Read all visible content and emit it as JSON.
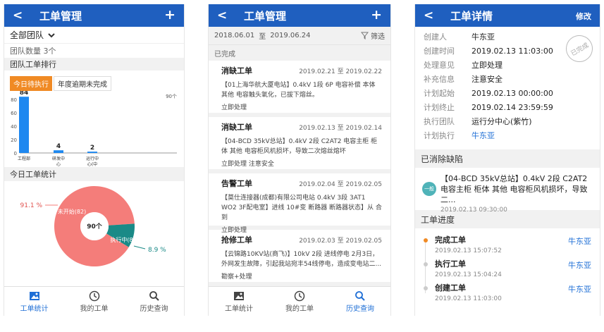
{
  "screen1": {
    "header": {
      "back": "<",
      "title": "工单管理",
      "add": "+"
    },
    "team_select": "全部团队",
    "team_count": "团队数量 3个",
    "ranking_title": "团队工单排行",
    "tabs": [
      "今日待执行",
      "年度逾期未完成"
    ],
    "count_label": "90个",
    "stats_title": "今日工单统计",
    "donut": {
      "center": "90个",
      "red_label": "未开始(82)",
      "teal_label": "执行中(8)",
      "red_pct": "91.1 %",
      "teal_pct": "8.9 %",
      "red_value": 82,
      "teal_value": 8,
      "red_color": "#f47d7a",
      "teal_color": "#1a8a87"
    },
    "tabbar": [
      {
        "label": "工单统计",
        "icon": "image-icon",
        "active": true
      },
      {
        "label": "我的工单",
        "icon": "clock-icon",
        "active": false
      },
      {
        "label": "历史查询",
        "icon": "search-icon",
        "active": false
      }
    ]
  },
  "chart_data": {
    "type": "bar",
    "categories": [
      "工程部",
      "研发中心",
      "运行中心"
    ],
    "values": [
      84,
      4,
      2
    ],
    "ylim": [
      0,
      80
    ],
    "yticks": [
      "0",
      "20",
      "40",
      "60",
      "80"
    ],
    "value_labels": [
      "84",
      "4",
      "2"
    ],
    "tick_labels": [
      [
        "工程部"
      ],
      [
        "研发中",
        "心"
      ],
      [
        "运行中",
        "心(中"
      ]
    ],
    "bar_color": "#1e88f0",
    "grid": false
  },
  "screen2": {
    "header": {
      "back": "<",
      "title": "工单管理",
      "add": "+"
    },
    "date_from": "2018.06.01",
    "date_sep": "至",
    "date_to": "2019.06.24",
    "filter": "筛选",
    "section": "已完成",
    "cards": [
      {
        "title": "消缺工单",
        "date": "2019.02.21 至 2019.02.22",
        "body": "【01上海华航大厦电站】0.4kV 1段 6P 电容补偿 本体 其他 电容触头氧化，已拔下熔丝。",
        "action": "立即处理"
      },
      {
        "title": "消缺工单",
        "date": "2019.02.13 至 2019.02.14",
        "body": "【04-BCD 35kV总站】0.4kV 2段 C2AT2 电容主柜 柜体 其他 电容柜风机损坏，导致二次熔丝熔坏",
        "action": "立即处理 注意安全"
      },
      {
        "title": "告警工单",
        "date": "2019.02.04 至 2019.02.05",
        "body": "【莫仕连接器(成都)有限公司电站 0.4kV 3段 3AT1 WO2 3F配电室】进线 10#变 断路器 断路器状态】从 合 到",
        "action": "立即处理"
      },
      {
        "title": "抢修工单",
        "date": "2019.02.03 至 2019.02.05",
        "body": "【云锦路10KV站(商飞)】10kV 2段 进线停电 2月3日，外网发生故障，引起我站宛丰54线停电，造成变电站二...",
        "action": "勘察+处理"
      }
    ],
    "tabbar": [
      {
        "label": "工单统计",
        "icon": "image-icon",
        "active": false
      },
      {
        "label": "我的工单",
        "icon": "clock-icon",
        "active": false
      },
      {
        "label": "历史查询",
        "icon": "search-icon",
        "active": true
      }
    ]
  },
  "screen3": {
    "header": {
      "back": "<",
      "title": "工单详情",
      "edit": "修改"
    },
    "stamp": "已完成",
    "fields": [
      {
        "k": "创建人",
        "v": "牛东亚"
      },
      {
        "k": "创建时间",
        "v": "2019.02.13 11:03:00"
      },
      {
        "k": "处理意见",
        "v": "立即处理"
      },
      {
        "k": "补充信息",
        "v": "注意安全"
      },
      {
        "k": "计划起始",
        "v": "2019.02.13 00:00:00"
      },
      {
        "k": "计划终止",
        "v": "2019.02.14 23:59:59"
      },
      {
        "k": "执行团队",
        "v": "运行分中心(紫竹)"
      },
      {
        "k": "计划执行",
        "v": "牛东亚"
      }
    ],
    "defects_title": "已消除缺陷",
    "defect": {
      "badge": "一般",
      "text": "【04-BCD 35kV总站】0.4kV 2段 C2AT2 电容主柜 柜体 其他 电容柜风机损坏，导致二...",
      "time": "2019.02.13 09:30:00"
    },
    "progress_title": "工单进度",
    "progress": [
      {
        "title": "完成工单",
        "time": "2019.02.13 15:07:52",
        "user": "牛东亚"
      },
      {
        "title": "执行工单",
        "time": "2019.02.13 15:04:24",
        "user": "牛东亚"
      },
      {
        "title": "创建工单",
        "time": "2019.02.13 11:03:00",
        "user": "牛东亚"
      }
    ]
  }
}
